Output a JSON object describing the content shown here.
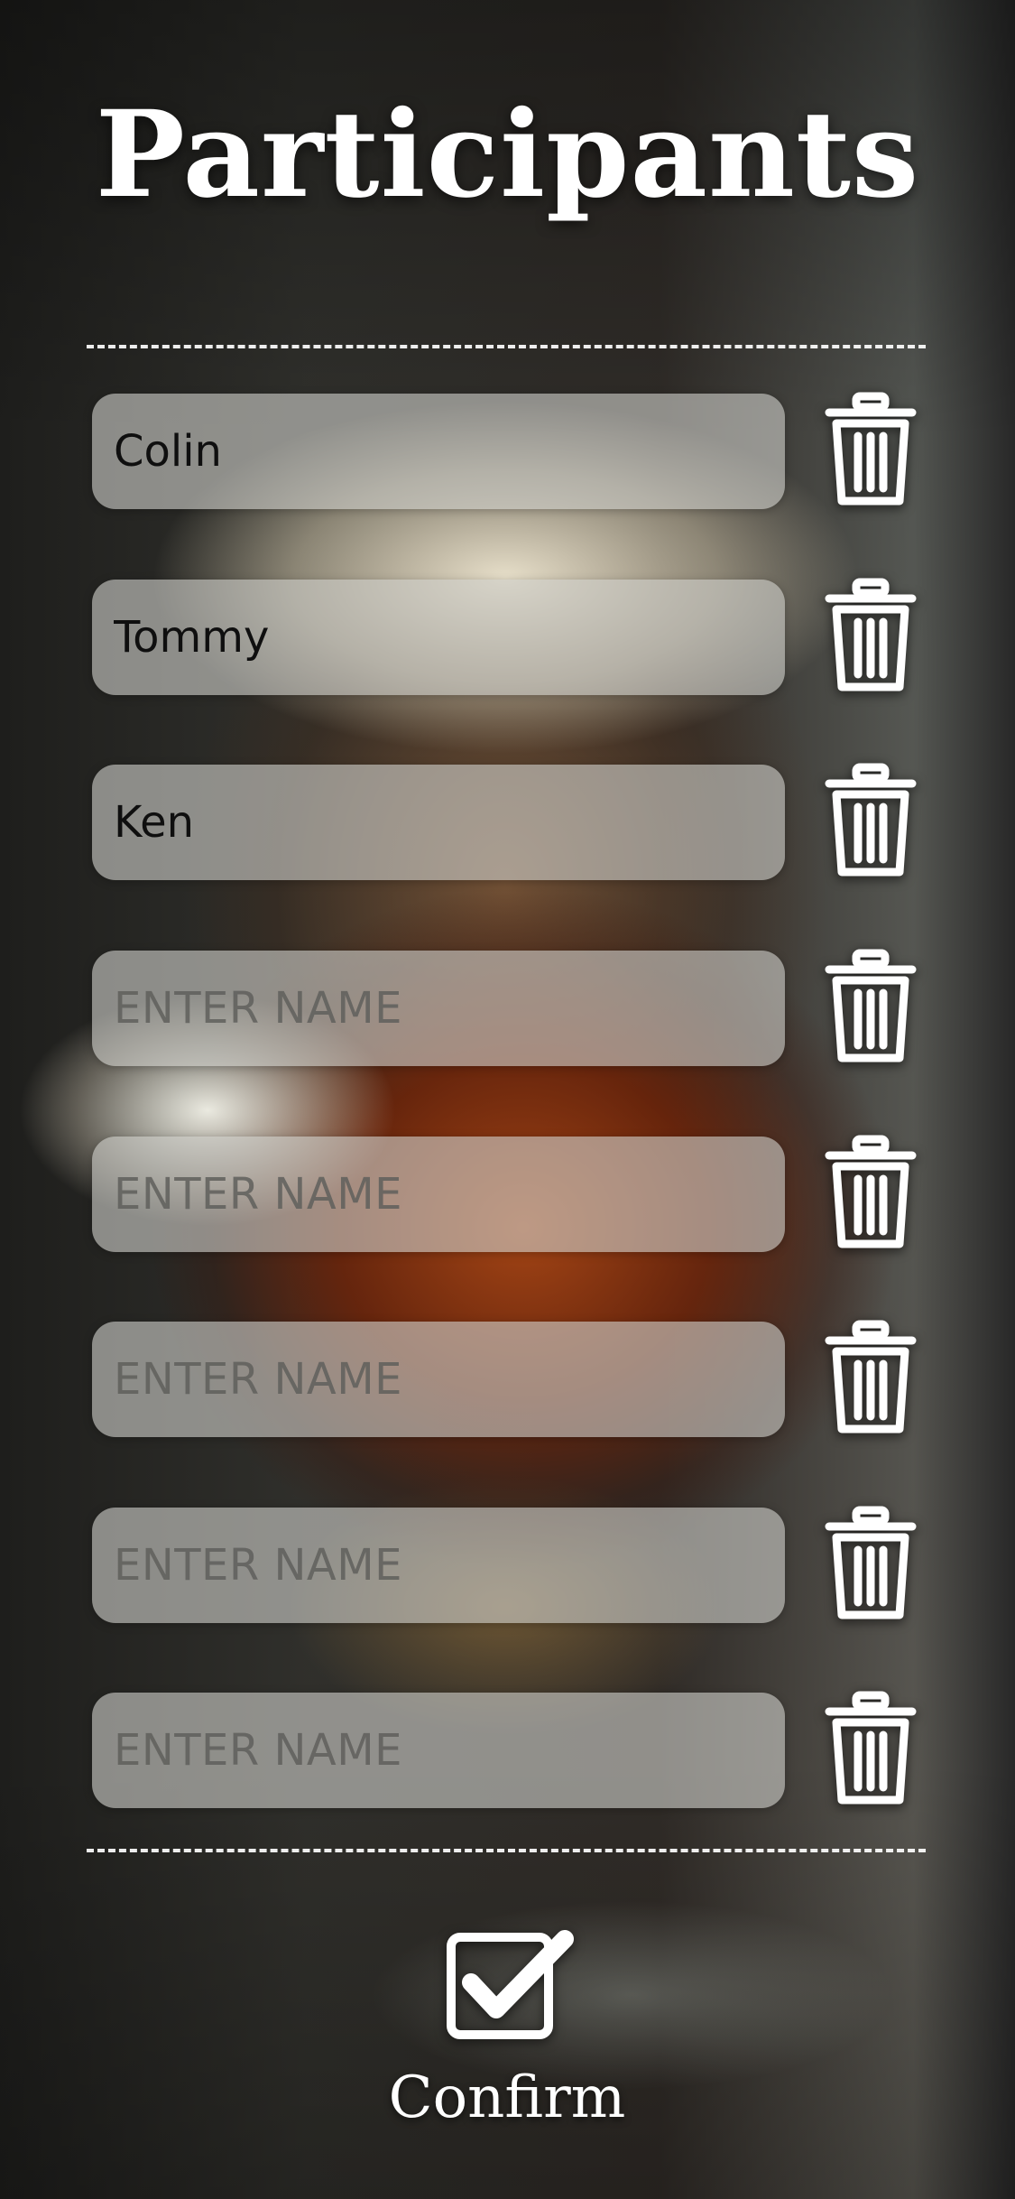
{
  "header": {
    "title": "Participants"
  },
  "participants": [
    {
      "value": "Colin",
      "placeholder": "ENTER NAME"
    },
    {
      "value": "Tommy",
      "placeholder": "ENTER NAME"
    },
    {
      "value": "Ken",
      "placeholder": "ENTER NAME"
    },
    {
      "value": "",
      "placeholder": "ENTER NAME"
    },
    {
      "value": "",
      "placeholder": "ENTER NAME"
    },
    {
      "value": "",
      "placeholder": "ENTER NAME"
    },
    {
      "value": "",
      "placeholder": "ENTER NAME"
    },
    {
      "value": "",
      "placeholder": "ENTER NAME"
    }
  ],
  "row_action_icon": "trash-icon",
  "confirm": {
    "label": "Confirm",
    "icon": "checkbox-checked-icon"
  },
  "colors": {
    "text_primary": "#ffffff",
    "field_background": "#cdcdc8",
    "placeholder_text": "#5f5f5c"
  }
}
